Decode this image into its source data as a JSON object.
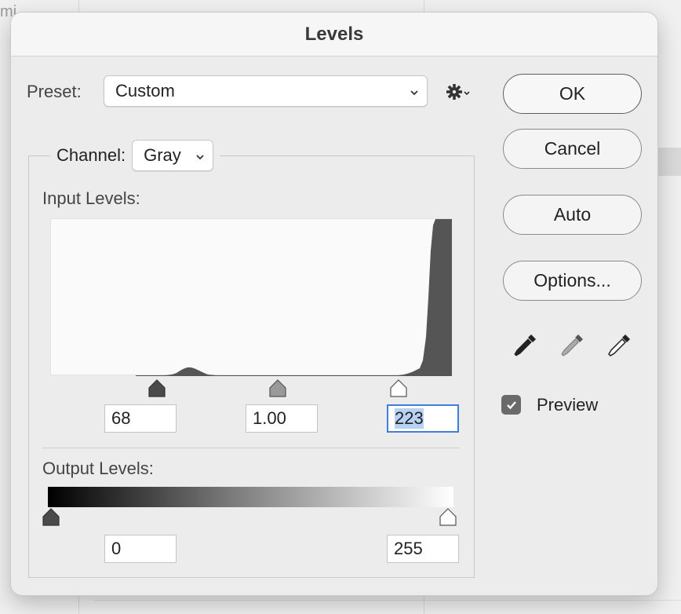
{
  "background": {
    "partial_text": "mi"
  },
  "dialog": {
    "title": "Levels",
    "preset": {
      "label": "Preset:",
      "value": "Custom"
    },
    "channel": {
      "label": "Channel:",
      "value": "Gray"
    },
    "input_levels": {
      "label": "Input Levels:",
      "black": "68",
      "gamma": "1.00",
      "white": "223"
    },
    "output_levels": {
      "label": "Output Levels:",
      "black": "0",
      "white": "255"
    },
    "buttons": {
      "ok": "OK",
      "cancel": "Cancel",
      "auto": "Auto",
      "options": "Options..."
    },
    "preview": {
      "label": "Preview",
      "checked": true
    },
    "icons": {
      "gear": "gear-icon",
      "eyedroppers": [
        "black-point-eyedropper-icon",
        "gray-point-eyedropper-icon",
        "white-point-eyedropper-icon"
      ]
    },
    "colors": {
      "focus_border": "#3f7fdc",
      "selection": "#b7d2f5",
      "histogram": "#555555"
    }
  }
}
